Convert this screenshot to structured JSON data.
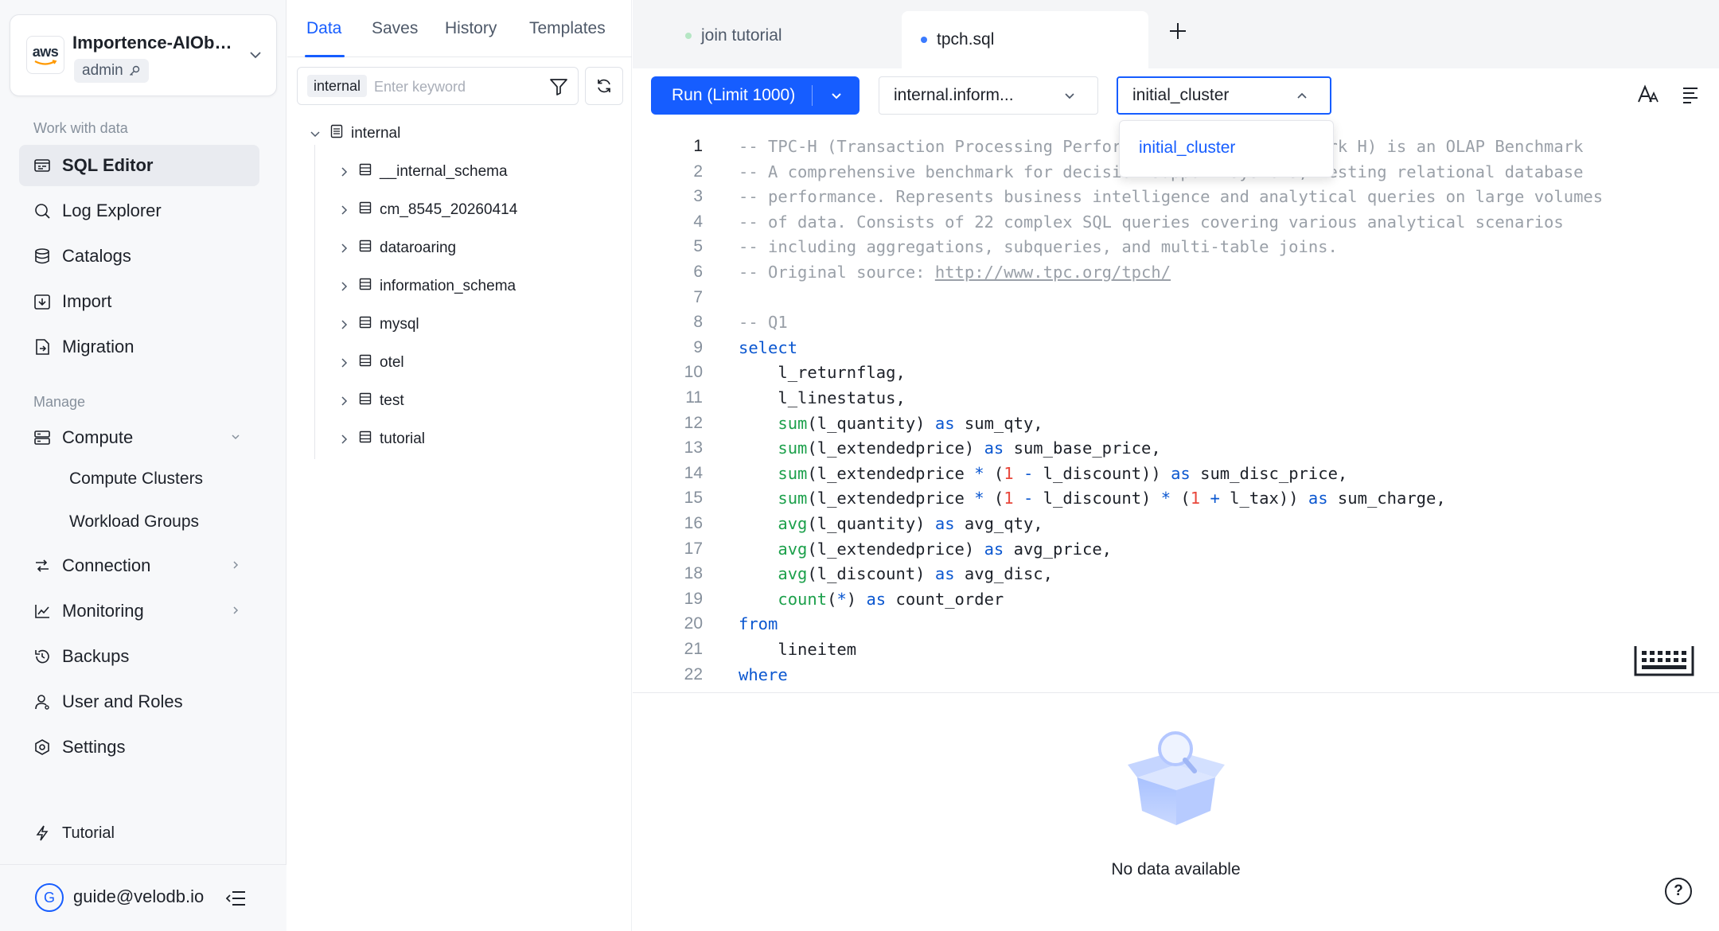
{
  "org": {
    "logo_text": "aws",
    "name": "Importence-AIObservability",
    "role": "admin"
  },
  "nav": {
    "section_work": "Work with data",
    "section_manage": "Manage",
    "items": [
      {
        "label": "SQL Editor",
        "icon": "sql-editor-icon"
      },
      {
        "label": "Log Explorer",
        "icon": "log-search-icon"
      },
      {
        "label": "Catalogs",
        "icon": "database-icon"
      },
      {
        "label": "Import",
        "icon": "import-icon"
      },
      {
        "label": "Migration",
        "icon": "migration-icon"
      },
      {
        "label": "Compute",
        "icon": "server-icon"
      },
      {
        "label": "Connection",
        "icon": "connection-icon"
      },
      {
        "label": "Monitoring",
        "icon": "chart-line-icon"
      },
      {
        "label": "Backups",
        "icon": "history-icon"
      },
      {
        "label": "User and Roles",
        "icon": "user-icon"
      },
      {
        "label": "Settings",
        "icon": "settings-icon"
      },
      {
        "label": "Tutorial",
        "icon": "bolt-icon"
      }
    ],
    "compute_sub": [
      "Compute Clusters",
      "Workload Groups"
    ]
  },
  "user": {
    "avatar_letter": "G",
    "email": "guide@velodb.io"
  },
  "panel": {
    "tabs": [
      "Data",
      "Saves",
      "History",
      "Templates"
    ],
    "search_scope": "internal",
    "search_placeholder": "Enter keyword",
    "tree_root": "internal",
    "schemas": [
      "__internal_schema",
      "cm_8545_20260414",
      "dataroaring",
      "information_schema",
      "mysql",
      "otel",
      "test",
      "tutorial"
    ]
  },
  "editor": {
    "tabs": [
      {
        "label": "join tutorial",
        "dot_color": "#b5e6c4"
      },
      {
        "label": "tpch.sql",
        "dot_color": "#3b7bff"
      }
    ],
    "run_label": "Run (Limit 1000)",
    "database_value": "internal.inform...",
    "cluster_value": "initial_cluster",
    "cluster_options": [
      "initial_cluster"
    ],
    "code_lines": [
      "-- TPC-H (Transaction Processing Performance Council Benchmark H) is an OLAP Benchmark",
      "-- A comprehensive benchmark for decision support systems, testing relational database",
      "-- performance. Represents business intelligence and analytical queries on large volumes",
      "-- of data. Consists of 22 complex SQL queries covering various analytical scenarios",
      "-- including aggregations, subqueries, and multi-table joins.",
      "-- Original source: http://www.tpc.org/tpch/",
      "",
      "-- Q1",
      "select",
      "    l_returnflag,",
      "    l_linestatus,",
      "    sum(l_quantity) as sum_qty,",
      "    sum(l_extendedprice) as sum_base_price,",
      "    sum(l_extendedprice * (1 - l_discount)) as sum_disc_price,",
      "    sum(l_extendedprice * (1 - l_discount) * (1 + l_tax)) as sum_charge,",
      "    avg(l_quantity) as avg_qty,",
      "    avg(l_extendedprice) as avg_price,",
      "    avg(l_discount) as avg_disc,",
      "    count(*) as count_order",
      "from",
      "    lineitem",
      "where"
    ]
  },
  "result": {
    "empty_text": "No data available"
  },
  "colors": {
    "accent": "#165dff",
    "sidebar_bg": "#f7f8fa",
    "keyword": "#0b57d0",
    "function": "#1ca04b",
    "number": "#e8473b",
    "comment": "#9aa0a8"
  }
}
